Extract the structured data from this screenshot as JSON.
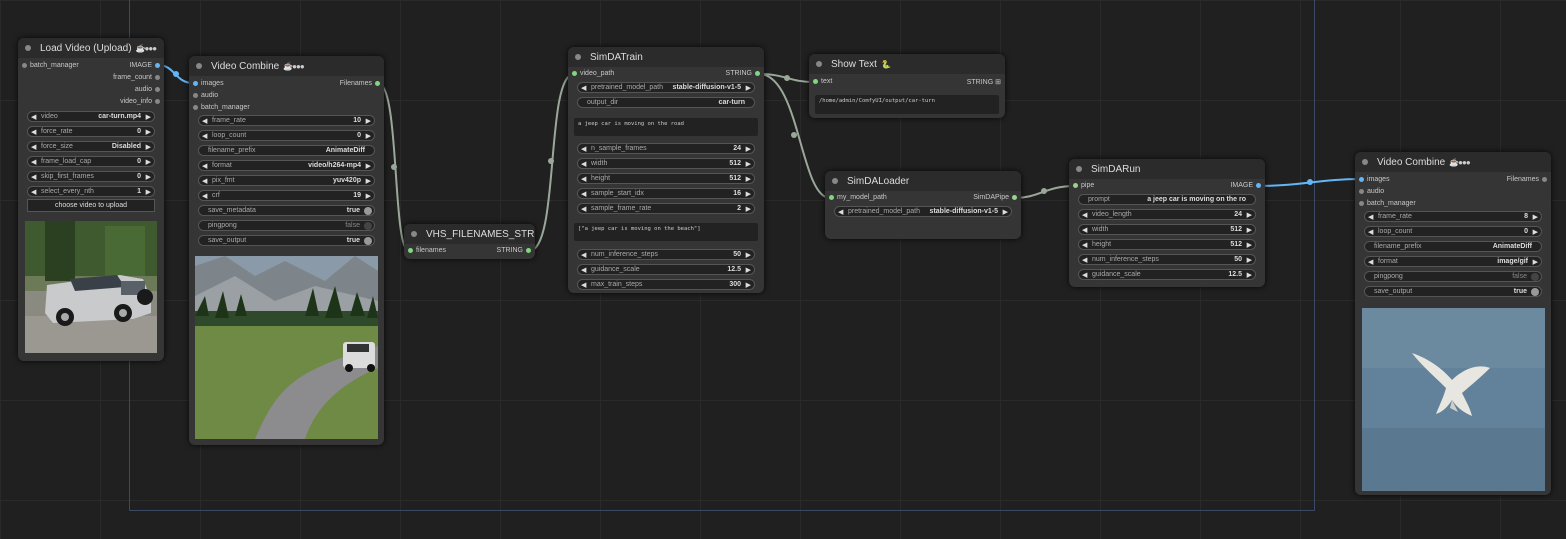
{
  "nodes": {
    "load_video": {
      "title": "Load Video (Upload)",
      "title_extra": "☕●●●",
      "inputs": [
        "batch_manager"
      ],
      "outputs": [
        "IMAGE",
        "frame_count",
        "audio",
        "video_info"
      ],
      "widgets": [
        {
          "label": "video",
          "value": "car-turn.mp4"
        },
        {
          "label": "force_rate",
          "value": "0"
        },
        {
          "label": "force_size",
          "value": "Disabled"
        },
        {
          "label": "frame_load_cap",
          "value": "0"
        },
        {
          "label": "skip_first_frames",
          "value": "0"
        },
        {
          "label": "select_every_nth",
          "value": "1"
        }
      ],
      "upload_button": "choose video to upload",
      "preview": "silver jeep in parking lot"
    },
    "video_combine_1": {
      "title": "Video Combine",
      "title_extra": "☕●●●",
      "inputs": [
        "images",
        "audio",
        "batch_manager"
      ],
      "outputs": [
        "Filenames"
      ],
      "widgets": [
        {
          "label": "frame_rate",
          "value": "10"
        },
        {
          "label": "loop_count",
          "value": "0"
        },
        {
          "label": "filename_prefix",
          "value": "AnimateDiff"
        },
        {
          "label": "format",
          "value": "video/h264-mp4"
        },
        {
          "label": "pix_fmt",
          "value": "yuv420p"
        },
        {
          "label": "crf",
          "value": "19"
        },
        {
          "label": "save_metadata",
          "value": "true"
        },
        {
          "label": "pingpong",
          "value": "false"
        },
        {
          "label": "save_output",
          "value": "true"
        }
      ],
      "preview": "jeep on mountain road"
    },
    "vhs_filenames": {
      "title": "VHS_FILENAMES_STRING_SimDA",
      "inputs": [
        "filenames"
      ],
      "outputs": [
        "STRING"
      ]
    },
    "simda_train": {
      "title": "SimDATrain",
      "inputs": [
        "video_path"
      ],
      "outputs": [
        "STRING"
      ],
      "widgets_top": [
        {
          "label": "pretrained_model_path",
          "value": "stable-diffusion-v1-5"
        },
        {
          "label": "output_dir",
          "value": "car-turn"
        }
      ],
      "prompt_text": "a jeep car is moving on the road",
      "widgets_mid": [
        {
          "label": "n_sample_frames",
          "value": "24"
        },
        {
          "label": "width",
          "value": "512"
        },
        {
          "label": "height",
          "value": "512"
        },
        {
          "label": "sample_start_idx",
          "value": "16"
        },
        {
          "label": "sample_frame_rate",
          "value": "2"
        }
      ],
      "validation_text": "[\"a jeep car is moving on the beach\"]",
      "widgets_bottom": [
        {
          "label": "num_inference_steps",
          "value": "50"
        },
        {
          "label": "guidance_scale",
          "value": "12.5"
        },
        {
          "label": "max_train_steps",
          "value": "300"
        }
      ]
    },
    "show_text": {
      "title": "Show Text",
      "title_extra": "🐍",
      "inputs": [
        "text"
      ],
      "outputs": [
        "STRING ⊞"
      ],
      "text": "/home/admin/ComfyUI/output/car-turn"
    },
    "simda_loader": {
      "title": "SimDALoader",
      "inputs": [
        "my_model_path"
      ],
      "outputs": [
        "SimDAPipe"
      ],
      "widgets": [
        {
          "label": "pretrained_model_path",
          "value": "stable-diffusion-v1-5"
        }
      ]
    },
    "simda_run": {
      "title": "SimDARun",
      "inputs": [
        "pipe"
      ],
      "outputs": [
        "IMAGE"
      ],
      "prompt_label": "prompt",
      "prompt_value": "a jeep car is moving on the ro",
      "widgets": [
        {
          "label": "video_length",
          "value": "24"
        },
        {
          "label": "width",
          "value": "512"
        },
        {
          "label": "height",
          "value": "512"
        },
        {
          "label": "num_inference_steps",
          "value": "50"
        },
        {
          "label": "guidance_scale",
          "value": "12.5"
        }
      ]
    },
    "video_combine_2": {
      "title": "Video Combine",
      "title_extra": "☕●●●",
      "inputs": [
        "images",
        "audio",
        "batch_manager"
      ],
      "outputs": [
        "Filenames"
      ],
      "widgets": [
        {
          "label": "frame_rate",
          "value": "8"
        },
        {
          "label": "loop_count",
          "value": "0"
        },
        {
          "label": "filename_prefix",
          "value": "AnimateDiff"
        },
        {
          "label": "format",
          "value": "image/gif"
        },
        {
          "label": "pingpong",
          "value": "false"
        },
        {
          "label": "save_output",
          "value": "true"
        }
      ],
      "preview": "bird flying over water"
    }
  },
  "colors": {
    "canvas": "#202020",
    "node_body": "#353535",
    "node_title": "#2b2b2b",
    "image_wire": "#64b5f6",
    "string_wire": "#9aa89a"
  }
}
